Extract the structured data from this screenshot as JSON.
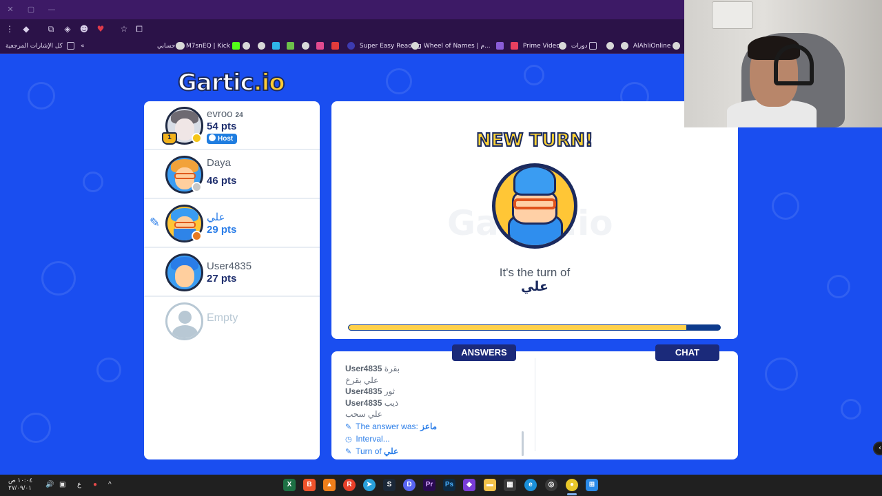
{
  "browser": {
    "toolbar_icons": [
      "menu-icon",
      "extension-icon",
      "puzzle-icon",
      "gem-icon",
      "avatar-icon",
      "heart-icon",
      "star-icon",
      "screenshot-icon"
    ],
    "bookmarks": [
      {
        "label": "AlAhliOnline",
        "icon": "globe-icon"
      },
      {
        "label": "",
        "icon": "globe-icon"
      },
      {
        "label": "دورات",
        "icon": "folder-icon"
      },
      {
        "label": "",
        "icon": "globe-icon"
      },
      {
        "label": "Prime Video",
        "icon": "prime-icon"
      },
      {
        "label": "Wheel of Names | م...",
        "icon": "globe-icon"
      },
      {
        "label": "Super Easy Reading",
        "icon": "globe-icon"
      },
      {
        "label": "M7snEQ | Kick",
        "icon": "kick-icon"
      },
      {
        "label": "حسابي",
        "icon": "globe-icon"
      }
    ],
    "all_bookmarks_label": "كل الإشارات المرجعية"
  },
  "game": {
    "logo_left": "Gartic",
    "logo_right": ".io",
    "players": [
      {
        "name": "evroo",
        "sub": "24",
        "points": "54 pts",
        "host_label": "Host",
        "rank": "1",
        "status_color": "#f5c518",
        "hair_color": "#6e6a72"
      },
      {
        "name": "Daya",
        "points": "46 pts",
        "status_color": "#c8c8c8",
        "hair_color": "#f2a23a"
      },
      {
        "name": "علي",
        "points": "29 pts",
        "status_color": "#e67a22",
        "hair_color": "#3a9cf2",
        "drawing": true
      },
      {
        "name": "User4835",
        "points": "27 pts",
        "status_color": null,
        "hair_color": "#3a9cf2"
      },
      {
        "name": "Empty",
        "points": "",
        "empty": true
      }
    ],
    "turn": {
      "headline": "NEW TURN!",
      "watermark": "Gartic.io",
      "turn_of_label": "It's the turn of",
      "player_name": "علي",
      "timer_progress": 0.91
    },
    "tabs": {
      "answers": "ANSWERS",
      "chat": "CHAT"
    },
    "answers": [
      {
        "user": "User4835",
        "text": "بقرة"
      },
      {
        "user": "",
        "text": "علي بقرخ"
      },
      {
        "user": "User4835",
        "text": "ثور"
      },
      {
        "user": "User4835",
        "text": "ذيب"
      },
      {
        "user": "",
        "text": "علي سحب"
      }
    ],
    "system_messages": [
      {
        "icon": "pencil-icon",
        "text": "The answer was: ",
        "value": "ماعز"
      },
      {
        "icon": "clock-icon",
        "text": "Interval...",
        "value": ""
      },
      {
        "icon": "pencil-icon",
        "text": "Turn of ",
        "value": "علي"
      }
    ]
  },
  "taskbar": {
    "time": "١٠:٠٤ ص",
    "date": "٢٧/٠٩/٠١",
    "lang": "ع",
    "apps": [
      "excel-icon",
      "brave-icon",
      "vlc-icon",
      "reddit-icon",
      "telegram-icon",
      "steam-icon",
      "discord-icon",
      "premiere-icon",
      "photoshop-icon",
      "stream-icon",
      "files-icon",
      "store-icon",
      "edge-icon",
      "obs-icon",
      "chrome-icon",
      "windows-icon"
    ]
  }
}
